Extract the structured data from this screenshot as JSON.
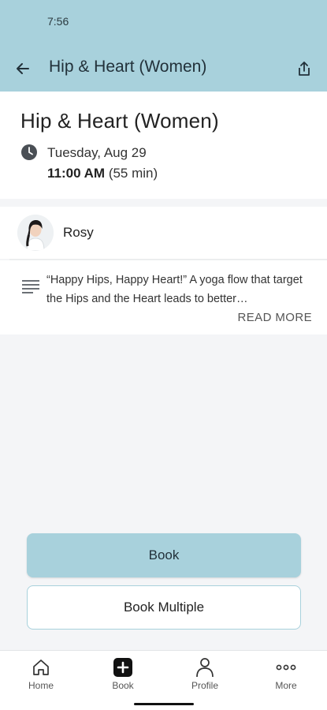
{
  "status_bar": {
    "time": "7:56"
  },
  "app_bar": {
    "title": "Hip & Heart (Women)"
  },
  "class": {
    "title": "Hip & Heart (Women)",
    "date": "Tuesday, Aug 29",
    "time": "11:00 AM",
    "duration": "(55 min)"
  },
  "instructor": {
    "name": "Rosy"
  },
  "description": {
    "text": "“Happy Hips, Happy Heart!” A yoga flow that target the Hips and the Heart leads to better…",
    "read_more": "READ MORE"
  },
  "actions": {
    "book_label": "Book",
    "book_multiple_label": "Book Multiple"
  },
  "nav": {
    "items": [
      {
        "label": "Home",
        "icon": "home-icon"
      },
      {
        "label": "Book",
        "icon": "plus-square-icon"
      },
      {
        "label": "Profile",
        "icon": "person-icon"
      },
      {
        "label": "More",
        "icon": "more-dots-icon"
      }
    ]
  },
  "colors": {
    "accent": "#a8d1dc",
    "background": "#f4f5f7"
  }
}
